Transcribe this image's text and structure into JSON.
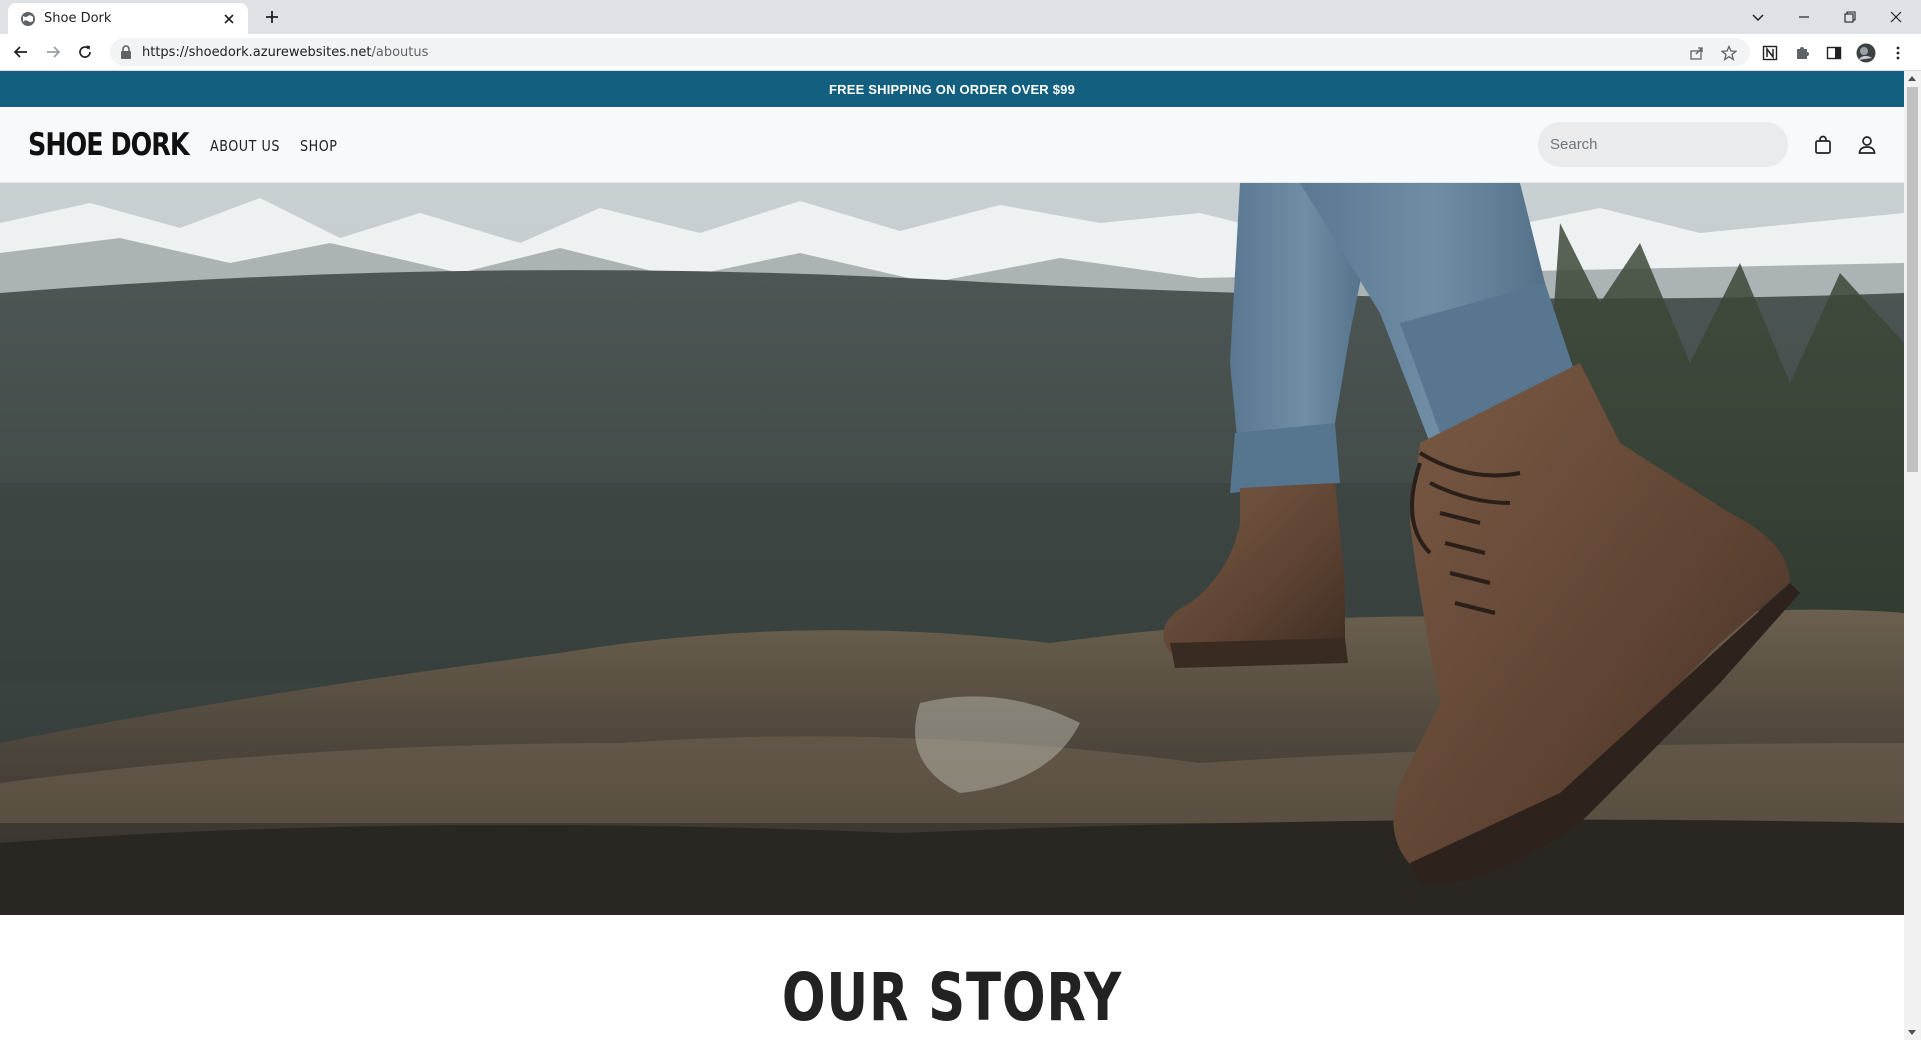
{
  "browser": {
    "tab_title": "Shoe Dork",
    "url_host": "https://shoedork.azurewebsites.net",
    "url_path": "/aboutus"
  },
  "site": {
    "promo_text": "FREE SHIPPING ON ORDER OVER $99",
    "logo": "SHOE DORK",
    "nav": [
      {
        "label": "ABOUT US"
      },
      {
        "label": "SHOP"
      }
    ],
    "search": {
      "placeholder": "Search",
      "value": ""
    },
    "icons": [
      "shopping-bag-icon",
      "user-icon"
    ],
    "hero": {
      "alt": "hiking boots on rocky mountain ridge"
    },
    "section_title": "OUR STORY"
  },
  "colors": {
    "promo_bar": "#125f7f",
    "header_bg": "#f8f9fa",
    "text_dark": "#222222"
  }
}
